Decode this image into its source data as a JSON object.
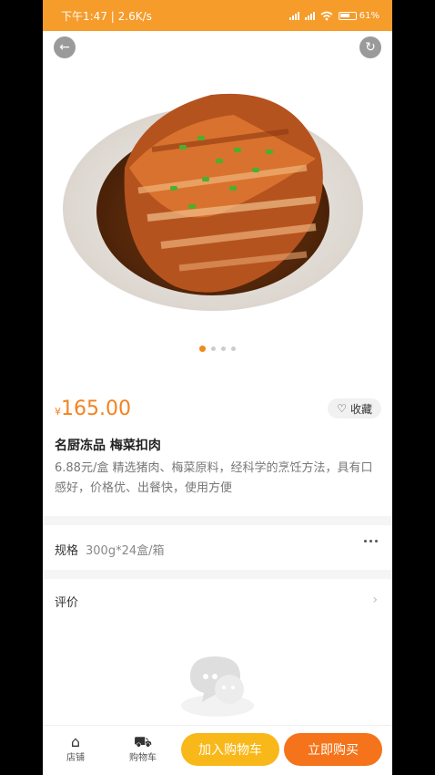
{
  "status_bar": {
    "time_speed": "下午1:47 | 2.6K/s",
    "battery": "61%"
  },
  "gallery": {
    "image_count": 4,
    "active_index": 0,
    "back_icon": "arrow-left-icon",
    "share_icon": "share-icon"
  },
  "product": {
    "currency": "¥",
    "price": "165.00",
    "favorite_label": "收藏",
    "title": "名厨冻品 梅菜扣肉",
    "description": "6.88元/盒 精选猪肉、梅菜原料，经科学的烹饪方法，具有口感好，价格优、出餐快，使用方便"
  },
  "spec": {
    "label": "规格",
    "value": "300g*24盒/箱"
  },
  "reviews": {
    "label": "评价"
  },
  "bottom_bar": {
    "store_label": "店铺",
    "cart_label": "购物车",
    "add_to_cart": "加入购物车",
    "buy_now": "立即购买"
  },
  "colors": {
    "status_bar": "#f59c2b",
    "accent": "#f5821f",
    "add_cart_btn": "#f9b81a",
    "buy_btn": "#f5731a"
  }
}
